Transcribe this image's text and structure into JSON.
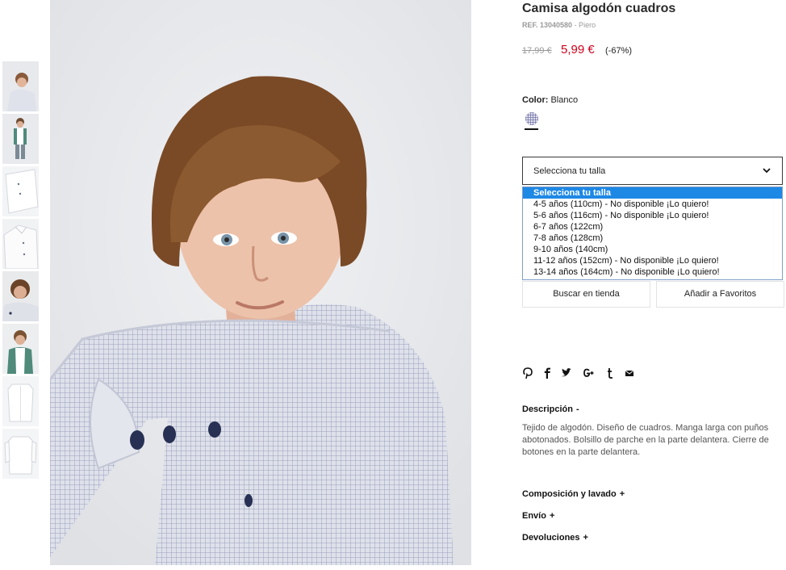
{
  "product": {
    "title": "Camisa algodón cuadros",
    "ref_label": "REF. 13040580",
    "ref_brand": "- Piero",
    "price_old": "17,99 €",
    "price_new": "5,99 €",
    "discount": "(-67%)"
  },
  "color": {
    "label": "Color:",
    "value": "Blanco"
  },
  "size_select": {
    "placeholder": "Selecciona tu talla",
    "options": [
      "Selecciona tu talla",
      "4-5 años (110cm) - No disponible ¡Lo quiero!",
      "5-6 años (116cm) - No disponible ¡Lo quiero!",
      "6-7 años (122cm)",
      "7-8 años (128cm)",
      "9-10 años (140cm)",
      "11-12 años (152cm) - No disponible ¡Lo quiero!",
      "13-14 años (164cm) - No disponible ¡Lo quiero!"
    ]
  },
  "actions": {
    "store": "Buscar en tienda",
    "favorites": "Añadir a Favoritos"
  },
  "share_icons": [
    "pinterest-icon",
    "facebook-icon",
    "twitter-icon",
    "google-plus-icon",
    "tumblr-icon",
    "email-icon"
  ],
  "description": {
    "title": "Descripción",
    "toggle": "-",
    "text": "Tejido de algodón. Diseño de cuadros. Manga larga con puños abotonados. Bolsillo de parche en la parte delantera. Cierre de botones en la parte delantera."
  },
  "sections": [
    {
      "title": "Composición y lavado",
      "toggle": "+"
    },
    {
      "title": "Envío",
      "toggle": "+"
    },
    {
      "title": "Devoluciones",
      "toggle": "+"
    }
  ],
  "colors": {
    "price_red": "#d0011b",
    "selected_option": "#1e88e5"
  }
}
